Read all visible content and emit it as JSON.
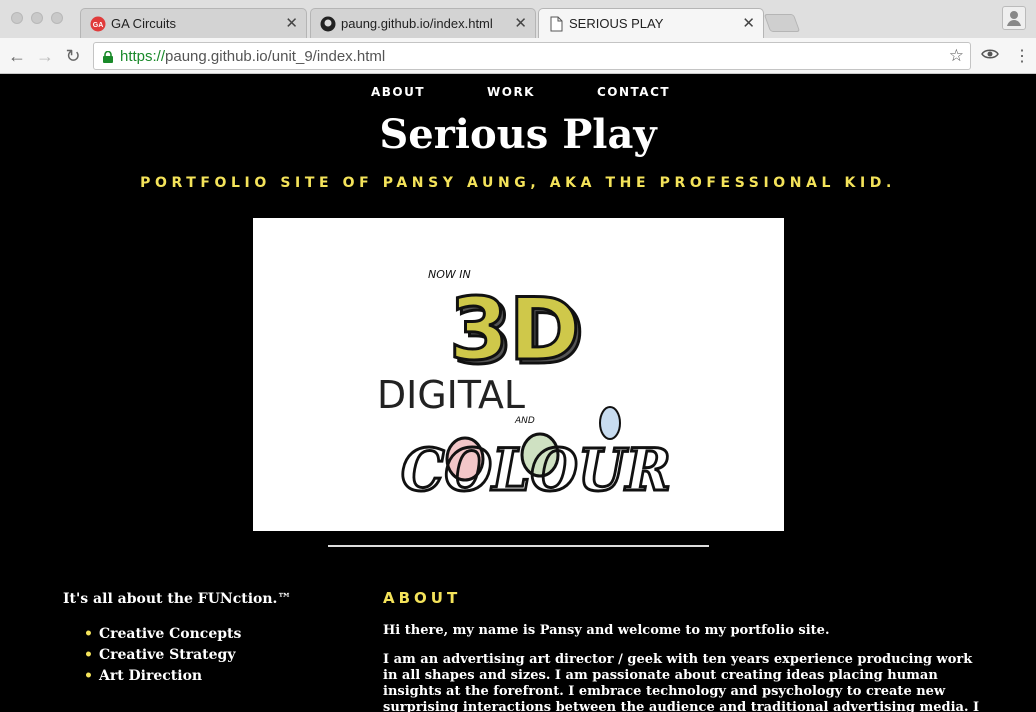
{
  "browser": {
    "tabs": [
      {
        "title": "GA Circuits",
        "icon": "ga-icon"
      },
      {
        "title": "paung.github.io/index.html at m",
        "icon": "github-icon"
      },
      {
        "title": "SERIOUS PLAY",
        "icon": "document-icon"
      }
    ],
    "url_scheme": "https://",
    "url_rest": "paung.github.io/unit_9/index.html"
  },
  "nav": {
    "items": [
      "ABOUT",
      "WORK",
      "CONTACT"
    ]
  },
  "site": {
    "title": "Serious Play",
    "tagline": "PORTFOLIO SITE OF PANSY AUNG, AKA THE PROFESSIONAL KID."
  },
  "hero": {
    "line1": "NOW IN",
    "line2": "3D",
    "line3": "DIGITAL",
    "line4": "AND",
    "line5": "COLOUR"
  },
  "function": {
    "heading": "It's all about the FUNction.™",
    "items": [
      "Creative Concepts",
      "Creative Strategy",
      "Art Direction"
    ]
  },
  "about": {
    "heading": "ABOUT",
    "p1": "Hi there, my name is Pansy and welcome to my portfolio site.",
    "p2": "I am an advertising art director / geek with ten years experience producing work in all shapes and sizes. I am passionate about creating ideas placing human insights at the forefront. I embrace technology and psychology to create new surprising interactions between the audience and traditional advertising media. I create awareness campaigns"
  },
  "colors": {
    "accent": "#f4e35a",
    "background": "#000000"
  }
}
